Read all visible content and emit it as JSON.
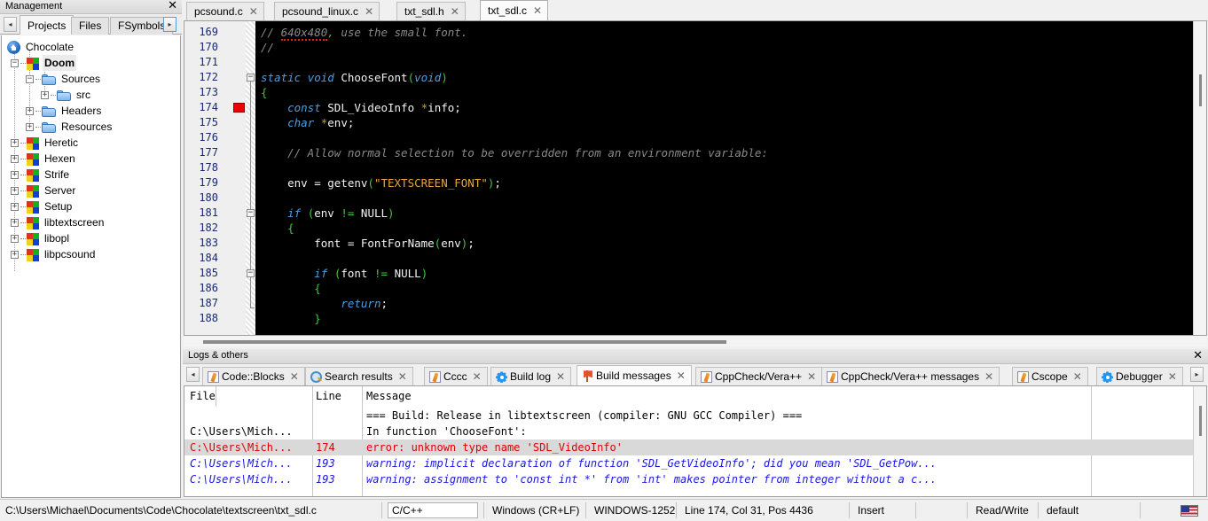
{
  "management": {
    "title": "Management",
    "close_label": "✕",
    "nav_left": "◂",
    "nav_right": "▸",
    "tabs": [
      {
        "label": "Projects",
        "selected": true
      },
      {
        "label": "Files",
        "selected": false
      },
      {
        "label": "FSymbols",
        "selected": false
      }
    ],
    "tree": [
      {
        "label": "Chocolate",
        "icon": "home-icon",
        "depth": 0,
        "expander": "",
        "bold": false
      },
      {
        "label": "Doom",
        "icon": "project-icon",
        "depth": 1,
        "expander": "−",
        "bold": true
      },
      {
        "label": "Sources",
        "icon": "folder-icon",
        "depth": 2,
        "expander": "−",
        "bold": false
      },
      {
        "label": "src",
        "icon": "folder-icon",
        "depth": 3,
        "expander": "+",
        "bold": false
      },
      {
        "label": "Headers",
        "icon": "folder-icon",
        "depth": 2,
        "expander": "+",
        "bold": false
      },
      {
        "label": "Resources",
        "icon": "folder-icon",
        "depth": 2,
        "expander": "+",
        "bold": false
      },
      {
        "label": "Heretic",
        "icon": "project-icon",
        "depth": 1,
        "expander": "+",
        "bold": false
      },
      {
        "label": "Hexen",
        "icon": "project-icon",
        "depth": 1,
        "expander": "+",
        "bold": false
      },
      {
        "label": "Strife",
        "icon": "project-icon",
        "depth": 1,
        "expander": "+",
        "bold": false
      },
      {
        "label": "Server",
        "icon": "project-icon",
        "depth": 1,
        "expander": "+",
        "bold": false
      },
      {
        "label": "Setup",
        "icon": "project-icon",
        "depth": 1,
        "expander": "+",
        "bold": false
      },
      {
        "label": "libtextscreen",
        "icon": "project-icon",
        "depth": 1,
        "expander": "+",
        "bold": false
      },
      {
        "label": "libopl",
        "icon": "project-icon",
        "depth": 1,
        "expander": "+",
        "bold": false
      },
      {
        "label": "libpcsound",
        "icon": "project-icon",
        "depth": 1,
        "expander": "+",
        "bold": false
      }
    ]
  },
  "editor": {
    "tabs": [
      {
        "label": "pcsound.c",
        "selected": false,
        "close": "✕"
      },
      {
        "label": "pcsound_linux.c",
        "selected": false,
        "close": "✕"
      },
      {
        "label": "txt_sdl.h",
        "selected": false,
        "close": "✕"
      },
      {
        "label": "txt_sdl.c",
        "selected": true,
        "close": "✕"
      }
    ],
    "first_line_number": 169,
    "line_numbers": [
      169,
      170,
      171,
      172,
      173,
      174,
      175,
      176,
      177,
      178,
      179,
      180,
      181,
      182,
      183,
      184,
      185,
      186,
      187,
      188
    ],
    "error_marker_line": 174,
    "fold_markers": [
      {
        "line": 173,
        "glyph": "−"
      },
      {
        "line": 182,
        "glyph": "−"
      },
      {
        "line": 186,
        "glyph": "−"
      }
    ],
    "code_lines": [
      {
        "n": 169,
        "tokens": [
          {
            "t": "// ",
            "c": "cm"
          },
          {
            "t": "640x480",
            "c": "cm sq"
          },
          {
            "t": ", use the small font.",
            "c": "cm"
          }
        ]
      },
      {
        "n": 170,
        "tokens": [
          {
            "t": "//",
            "c": "cm"
          }
        ]
      },
      {
        "n": 171,
        "tokens": []
      },
      {
        "n": 172,
        "tokens": [
          {
            "t": "static",
            "c": "kw"
          },
          {
            "t": " ",
            "c": "id"
          },
          {
            "t": "void",
            "c": "kw"
          },
          {
            "t": " ChooseFont",
            "c": "id"
          },
          {
            "t": "(",
            "c": "op"
          },
          {
            "t": "void",
            "c": "kw"
          },
          {
            "t": ")",
            "c": "op"
          }
        ]
      },
      {
        "n": 173,
        "tokens": [
          {
            "t": "{",
            "c": "op"
          }
        ]
      },
      {
        "n": 174,
        "tokens": [
          {
            "t": "    ",
            "c": "id"
          },
          {
            "t": "const",
            "c": "kw"
          },
          {
            "t": " SDL_VideoInfo ",
            "c": "id"
          },
          {
            "t": "*",
            "c": "st"
          },
          {
            "t": "info",
            "c": "id"
          },
          {
            "t": ";",
            "c": "id"
          }
        ]
      },
      {
        "n": 175,
        "tokens": [
          {
            "t": "    ",
            "c": "id"
          },
          {
            "t": "char",
            "c": "kw"
          },
          {
            "t": " ",
            "c": "id"
          },
          {
            "t": "*",
            "c": "st"
          },
          {
            "t": "env",
            "c": "id"
          },
          {
            "t": ";",
            "c": "id"
          }
        ]
      },
      {
        "n": 176,
        "tokens": []
      },
      {
        "n": 177,
        "tokens": [
          {
            "t": "    // Allow normal selection to be overridden from an environment variable:",
            "c": "cm"
          }
        ]
      },
      {
        "n": 178,
        "tokens": []
      },
      {
        "n": 179,
        "tokens": [
          {
            "t": "    env = getenv",
            "c": "id"
          },
          {
            "t": "(",
            "c": "op"
          },
          {
            "t": "\"TEXTSCREEN_FONT\"",
            "c": "str"
          },
          {
            "t": ")",
            "c": "op"
          },
          {
            "t": ";",
            "c": "id"
          }
        ]
      },
      {
        "n": 180,
        "tokens": []
      },
      {
        "n": 181,
        "tokens": [
          {
            "t": "    ",
            "c": "id"
          },
          {
            "t": "if",
            "c": "kw"
          },
          {
            "t": " ",
            "c": "id"
          },
          {
            "t": "(",
            "c": "op"
          },
          {
            "t": "env ",
            "c": "id"
          },
          {
            "t": "!=",
            "c": "op"
          },
          {
            "t": " NULL",
            "c": "id"
          },
          {
            "t": ")",
            "c": "op"
          }
        ]
      },
      {
        "n": 182,
        "tokens": [
          {
            "t": "    ",
            "c": "id"
          },
          {
            "t": "{",
            "c": "op"
          }
        ]
      },
      {
        "n": 183,
        "tokens": [
          {
            "t": "        font = FontForName",
            "c": "id"
          },
          {
            "t": "(",
            "c": "op"
          },
          {
            "t": "env",
            "c": "id"
          },
          {
            "t": ")",
            "c": "op"
          },
          {
            "t": ";",
            "c": "id"
          }
        ]
      },
      {
        "n": 184,
        "tokens": []
      },
      {
        "n": 185,
        "tokens": [
          {
            "t": "        ",
            "c": "id"
          },
          {
            "t": "if",
            "c": "kw"
          },
          {
            "t": " ",
            "c": "id"
          },
          {
            "t": "(",
            "c": "op"
          },
          {
            "t": "font ",
            "c": "id"
          },
          {
            "t": "!=",
            "c": "op"
          },
          {
            "t": " NULL",
            "c": "id"
          },
          {
            "t": ")",
            "c": "op"
          }
        ]
      },
      {
        "n": 186,
        "tokens": [
          {
            "t": "        ",
            "c": "id"
          },
          {
            "t": "{",
            "c": "op"
          }
        ]
      },
      {
        "n": 187,
        "tokens": [
          {
            "t": "            ",
            "c": "id"
          },
          {
            "t": "return",
            "c": "kw"
          },
          {
            "t": ";",
            "c": "id"
          }
        ]
      },
      {
        "n": 188,
        "tokens": [
          {
            "t": "        ",
            "c": "id"
          },
          {
            "t": "}",
            "c": "op"
          }
        ]
      }
    ]
  },
  "logs": {
    "title": "Logs & others",
    "close_label": "✕",
    "nav_left": "◂",
    "nav_right": "▸",
    "tabs": [
      {
        "label": "Code::Blocks",
        "icon": "pencil-icon",
        "selected": false,
        "close": "✕"
      },
      {
        "label": "Search results",
        "icon": "magnifier-icon",
        "selected": false,
        "close": "✕"
      },
      {
        "label": "Cccc",
        "icon": "pencil-icon",
        "selected": false,
        "close": "✕"
      },
      {
        "label": "Build log",
        "icon": "gear-icon",
        "selected": false,
        "close": "✕"
      },
      {
        "label": "Build messages",
        "icon": "flag-icon",
        "selected": true,
        "close": "✕"
      },
      {
        "label": "CppCheck/Vera++",
        "icon": "pencil-icon",
        "selected": false,
        "close": "✕"
      },
      {
        "label": "CppCheck/Vera++ messages",
        "icon": "pencil-icon",
        "selected": false,
        "close": "✕"
      },
      {
        "label": "Cscope",
        "icon": "pencil-icon",
        "selected": false,
        "close": "✕"
      },
      {
        "label": "Debugger",
        "icon": "gear-icon",
        "selected": false,
        "close": "✕"
      }
    ],
    "columns": [
      "File",
      "Line",
      "Message"
    ],
    "rows": [
      {
        "file": "",
        "line": "",
        "message": "=== Build: Release in libtextscreen (compiler: GNU GCC Compiler) ===",
        "style": "t-black",
        "selected": false
      },
      {
        "file": "C:\\Users\\Mich...",
        "line": "",
        "message": "In function 'ChooseFont':",
        "style": "t-black",
        "selected": false
      },
      {
        "file": "C:\\Users\\Mich...",
        "line": "174",
        "message": "error: unknown type name 'SDL_VideoInfo'",
        "style": "t-red",
        "selected": true
      },
      {
        "file": "C:\\Users\\Mich...",
        "line": "193",
        "message": "warning: implicit declaration of function 'SDL_GetVideoInfo'; did you mean 'SDL_GetPow...",
        "style": "t-blue",
        "selected": false
      },
      {
        "file": "C:\\Users\\Mich...",
        "line": "193",
        "message": "warning: assignment to 'const int *' from 'int' makes pointer from integer without a c...",
        "style": "t-blue",
        "selected": false
      }
    ]
  },
  "status": {
    "file_path": "C:\\Users\\Michael\\Documents\\Code\\Chocolate\\textscreen\\txt_sdl.c",
    "language": "C/C++",
    "line_endings": "Windows (CR+LF)",
    "encoding": "WINDOWS-1252",
    "cursor": "Line 174, Col 31, Pos 4436",
    "insert_mode": "Insert",
    "blank": "",
    "access_mode": "Read/Write",
    "profile": "default",
    "flag": "us-flag-icon"
  }
}
